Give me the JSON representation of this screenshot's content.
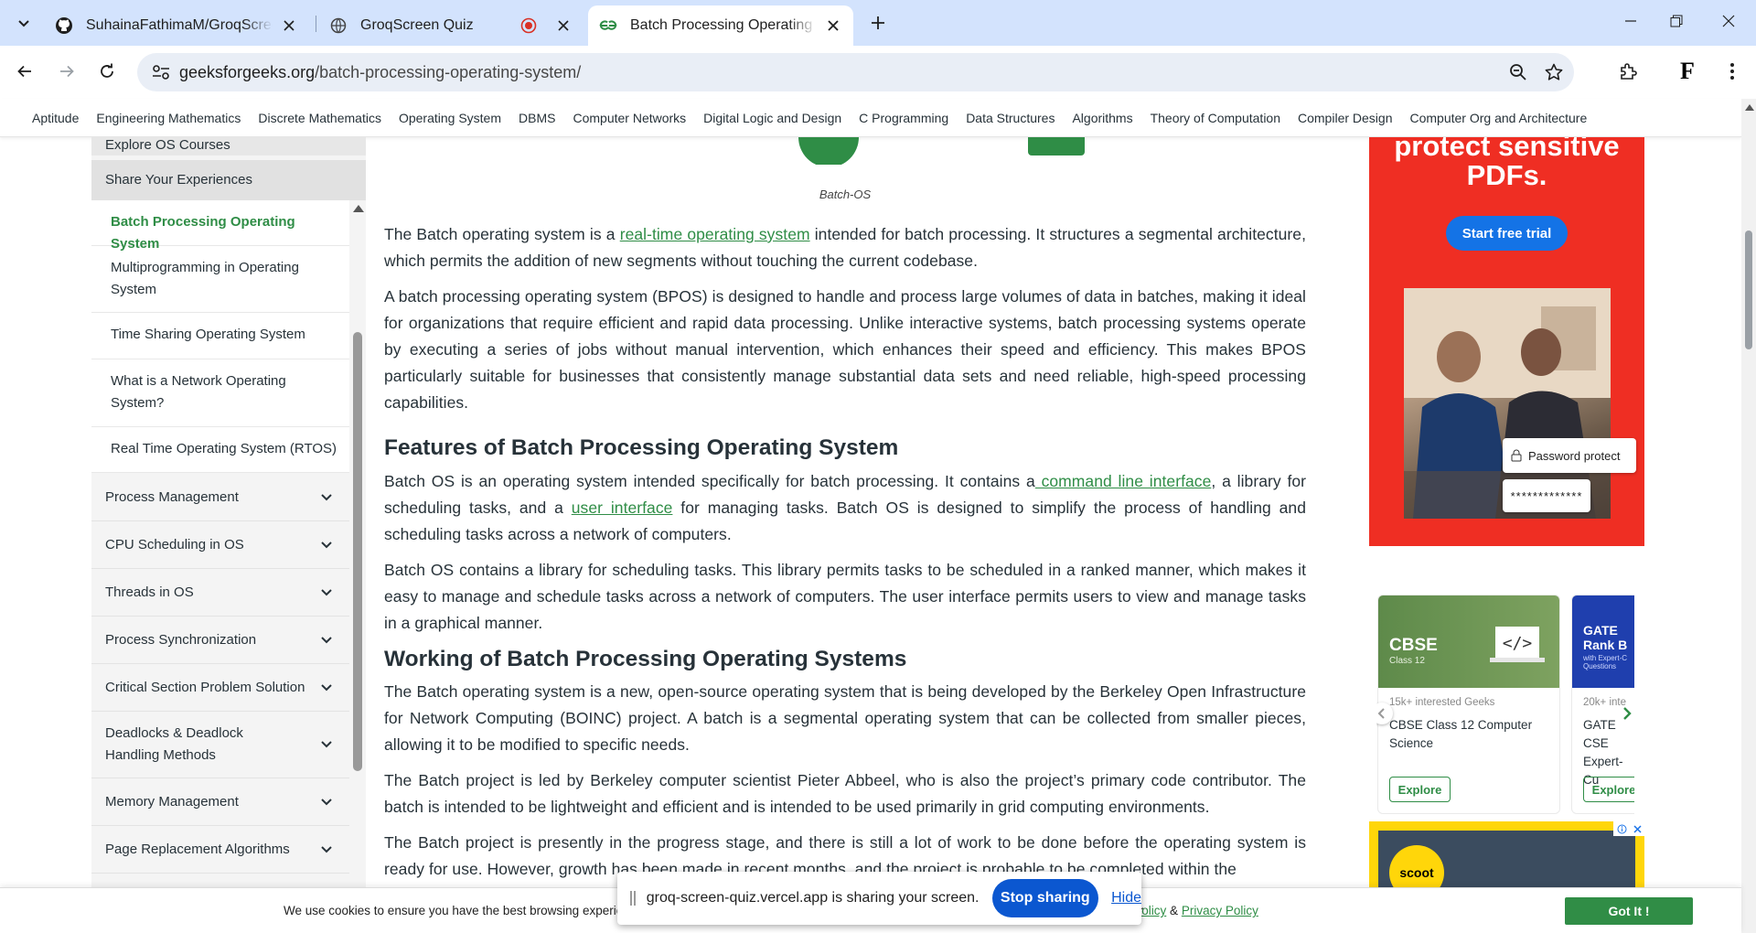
{
  "browser": {
    "tabs": [
      {
        "title": "SuhainaFathimaM/GroqScreen-Quiz",
        "icon": "github-icon"
      },
      {
        "title": "GroqScreen Quiz",
        "icon": "globe-icon",
        "recording": true
      },
      {
        "title": "Batch Processing Operating System",
        "icon": "gfg-logo-icon",
        "active": true
      }
    ],
    "url_host": "geeksforgeeks.org",
    "url_path": "/batch-processing-operating-system/",
    "profile_initial": "F"
  },
  "subnav": [
    "Aptitude",
    "Engineering Mathematics",
    "Discrete Mathematics",
    "Operating System",
    "DBMS",
    "Computer Networks",
    "Digital Logic and Design",
    "C Programming",
    "Data Structures",
    "Algorithms",
    "Theory of Computation",
    "Compiler Design",
    "Computer Org and Architecture"
  ],
  "sidebar": {
    "top_item": "Explore OS Courses",
    "share": "Share Your Experiences",
    "sub_items": [
      {
        "label": "Batch Processing Operating System",
        "active": true
      },
      {
        "label": "Multiprogramming in Operating System"
      },
      {
        "label": "Time Sharing Operating System"
      },
      {
        "label": "What is a Network Operating System?"
      },
      {
        "label": "Real Time Operating System (RTOS)"
      }
    ],
    "categories": [
      "Process Management",
      "CPU Scheduling in OS",
      "Threads in OS",
      "Process Synchronization",
      "Critical Section Problem Solution",
      "Deadlocks & Deadlock Handling Methods",
      "Memory Management",
      "Page Replacement Algorithms"
    ]
  },
  "article": {
    "caption": "Batch-OS",
    "p1_a": "The Batch operating system is a ",
    "p1_link": "real-time operating system",
    "p1_b": " intended for batch processing. It structures a segmental architecture, which permits the addition of new segments without touching the current codebase.",
    "p2": "A batch processing operating system (BPOS) is designed to handle and process large volumes of data in batches, making it ideal for organizations that require efficient and rapid data processing. Unlike interactive systems, batch processing systems operate by executing a series of jobs without manual intervention, which enhances their speed and efficiency. This makes BPOS particularly suitable for businesses that consistently manage substantial data sets and need reliable, high-speed processing capabilities.",
    "h_features": "Features of Batch Processing Operating System",
    "p3_a": "Batch OS is an operating system intended specifically for batch processing. It contains a",
    "p3_link1": " command line interface",
    "p3_b": ", a library for scheduling tasks, and a ",
    "p3_link2": "user interface",
    "p3_c": " for managing tasks. Batch OS is designed to simplify the process of handling and scheduling tasks across a network of computers.",
    "p4": "Batch OS contains a library for scheduling tasks. This library permits tasks to be scheduled in a ranked manner, which makes it easy to manage and schedule tasks across a network of computers. The user interface permits users to view and manage tasks in a graphical manner.",
    "h_working": "Working of Batch Processing Operating Systems",
    "p5": "The Batch operating system is a new, open-source operating system that is being developed by the Berkeley Open Infrastructure for Network Computing (BOINC) project. A batch is a segmental operating system that can be collected from smaller pieces, allowing it to be modified to specific needs.",
    "p6": "The Batch project is led by Berkeley computer scientist Pieter Abbeel, who is also the project’s primary code contributor. The batch is intended to be lightweight and efficient and is intended to be used primarily in grid computing environments.",
    "p7": "The Batch project is presently in the progress stage, and there is still a lot of work to be done before the operating system is ready for use. However, growth has been made in recent months, and the project is probable to be completed within the"
  },
  "ads": {
    "pdf_headline": "protect sensitive PDFs.",
    "pdf_cta": "Start free trial",
    "pdf_chip": "Password protect",
    "pdf_password": "*************",
    "cards": [
      {
        "band_title": "CBSE",
        "band_sub": "Class 12",
        "meta": "15k+ interested Geeks",
        "title": "CBSE Class 12 Computer Science",
        "cta": "Explore"
      },
      {
        "band_title": "GATE Rank B",
        "band_sub": "with Expert-C Questions",
        "meta": "20k+ inte",
        "title": "GATE CSE Expert-Cu",
        "cta": "Explore"
      }
    ],
    "scoot": "scoot"
  },
  "cookie": {
    "message": "We use cookies to ensure you have the best browsing experience on our website. By using our site, you acknowledge that you have read and understood our",
    "cookie_policy": "ie Policy",
    "amp": "&",
    "privacy_policy": "Privacy Policy",
    "accept": "Got It !"
  },
  "share_bar": {
    "text": "groq-screen-quiz.vercel.app is sharing your screen.",
    "stop": "Stop sharing",
    "hide": "Hide"
  },
  "colors": {
    "accent_green": "#2f8d46",
    "tabstrip": "#d3e3fd",
    "ad_red": "#ef2e23",
    "chrome_blue": "#0b57d0"
  }
}
